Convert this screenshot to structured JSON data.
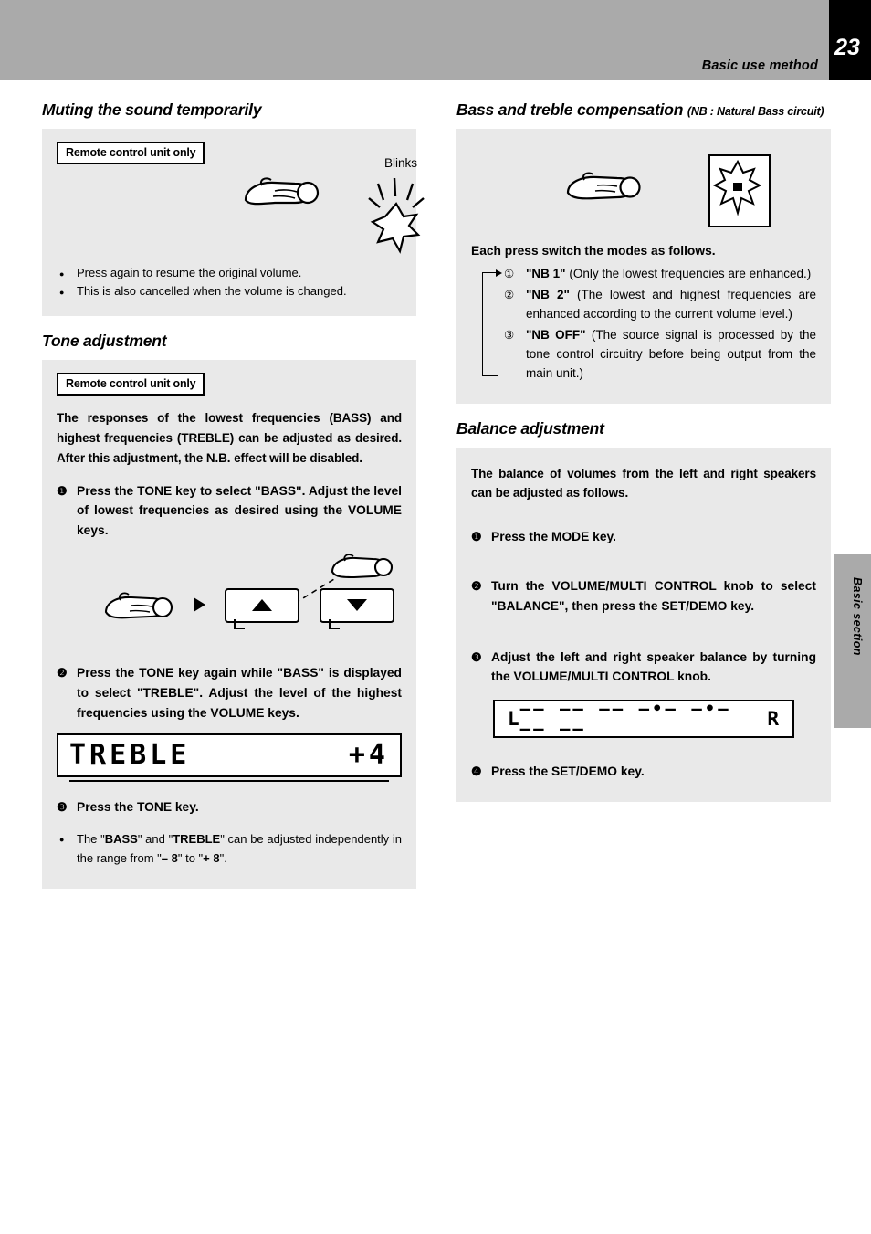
{
  "header": {
    "title": "Basic use method",
    "page_number": "23",
    "side_tab": "Basic section"
  },
  "left": {
    "muting": {
      "heading": "Muting the sound temporarily",
      "badge": "Remote control unit only",
      "blinks_label": "Blinks",
      "bullets": [
        "Press again to resume the original volume.",
        "This is also cancelled when the volume is changed."
      ]
    },
    "tone": {
      "heading": "Tone adjustment",
      "badge": "Remote control unit only",
      "intro": "The responses of the lowest frequencies (BASS) and highest frequencies (TREBLE) can be adjusted as desired. After this adjustment, the N.B. effect will be disabled.",
      "step1_num": "❶",
      "step1": "Press the TONE key to select \"BASS\". Adjust the level of lowest frequencies as desired using the VOLUME keys.",
      "step2_num": "❷",
      "step2": "Press the TONE key again while \"BASS\" is displayed to select \"TREBLE\". Adjust the level of the highest frequencies using the VOLUME keys.",
      "step3_num": "❸",
      "step3": "Press the TONE key.",
      "lcd_label": "TREBLE",
      "lcd_value": "+4",
      "note_prefix": "The \"",
      "note_bass": "BASS",
      "note_mid1": "\" and \"",
      "note_treble": "TREBLE",
      "note_mid2": "\" can be adjusted independently in the range from \"",
      "note_min": "– 8",
      "note_mid3": "\" to \"",
      "note_max": "+ 8",
      "note_end": "\"."
    }
  },
  "right": {
    "bass_treble": {
      "heading": "Bass and treble compensation",
      "heading_sub": "(NB : Natural Bass circuit)",
      "each_press": "Each press switch the modes as follows.",
      "modes": [
        {
          "num": "①",
          "label": "\"NB 1\"",
          "text": "(Only the lowest frequencies are enhanced.)"
        },
        {
          "num": "②",
          "label": "\"NB 2\"",
          "text": "(The lowest and highest frequencies are enhanced according to the current volume level.)"
        },
        {
          "num": "③",
          "label": "\"NB OFF\"",
          "text": "(The source signal is processed by the tone control circuitry before being output from the main unit.)"
        }
      ]
    },
    "balance": {
      "heading": "Balance adjustment",
      "intro": "The balance of volumes from the left and right speakers can be adjusted as follows.",
      "step1_num": "❶",
      "step1": "Press the MODE key.",
      "step2_num": "❷",
      "step2": "Turn the VOLUME/MULTI CONTROL knob to select \"BALANCE\", then press the SET/DEMO key.",
      "step3_num": "❸",
      "step3": "Adjust the left and right speaker balance by turning the VOLUME/MULTI CONTROL knob.",
      "step4_num": "❹",
      "step4": "Press the SET/DEMO key.",
      "lcd_left": "L",
      "lcd_middle": "–– –– –– –•– –•– –– ––",
      "lcd_right": "R"
    }
  }
}
